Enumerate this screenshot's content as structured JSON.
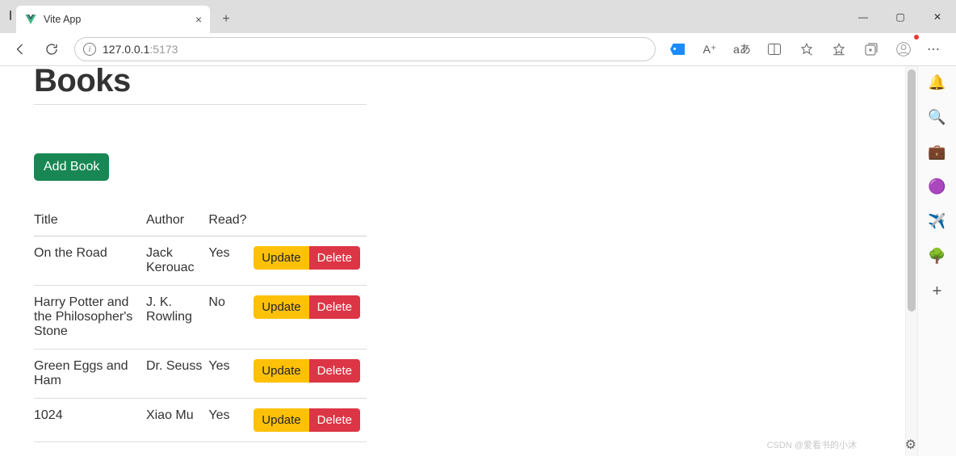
{
  "window": {
    "tab_title": "Vite App",
    "min": "—",
    "max": "▢",
    "close": "✕"
  },
  "toolbar": {
    "url_host": "127.0.0.1",
    "url_port": ":5173",
    "aa": "A⁺",
    "translate": "aあ"
  },
  "page": {
    "heading": "Books",
    "add_label": "Add Book",
    "columns": {
      "title": "Title",
      "author": "Author",
      "read": "Read?"
    },
    "actions": {
      "update": "Update",
      "delete": "Delete"
    },
    "books": [
      {
        "title": "On the Road",
        "author": "Jack Kerouac",
        "read": "Yes"
      },
      {
        "title": "Harry Potter and the Philosopher's Stone",
        "author": "J. K. Rowling",
        "read": "No"
      },
      {
        "title": "Green Eggs and Ham",
        "author": "Dr. Seuss",
        "read": "Yes"
      },
      {
        "title": "1024",
        "author": "Xiao Mu",
        "read": "Yes"
      }
    ]
  },
  "watermark": "CSDN @爱看书的小沐"
}
